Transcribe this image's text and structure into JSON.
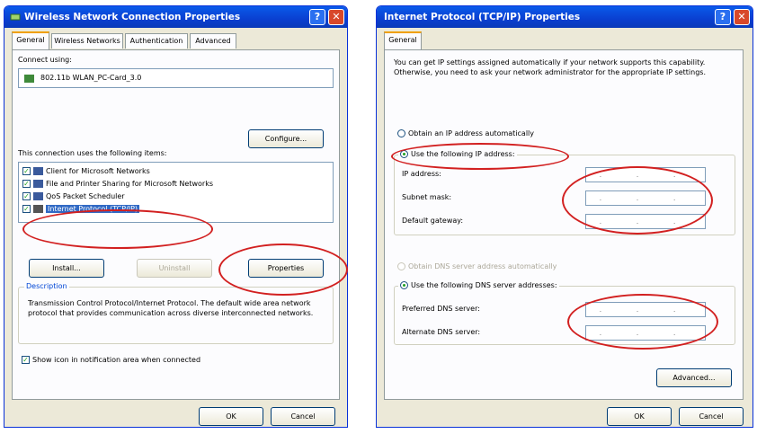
{
  "left_dialog": {
    "title": "Wireless Network Connection Properties",
    "tabs": [
      "General",
      "Wireless Networks",
      "Authentication",
      "Advanced"
    ],
    "connect_using_label": "Connect using:",
    "adapter_name": "802.11b WLAN_PC-Card_3.0",
    "configure_label": "Configure...",
    "items_label": "This connection uses the following items:",
    "items": [
      {
        "label": "Client for Microsoft Networks",
        "checked": true
      },
      {
        "label": "File and Printer Sharing for Microsoft Networks",
        "checked": true
      },
      {
        "label": "QoS Packet Scheduler",
        "checked": true
      },
      {
        "label": "Internet Protocol (TCP/IP)",
        "checked": true,
        "selected": true
      }
    ],
    "install_label": "Install...",
    "uninstall_label": "Uninstall",
    "properties_label": "Properties",
    "description_group": "Description",
    "description_text": "Transmission Control Protocol/Internet Protocol. The default wide area network protocol that provides communication across diverse interconnected networks.",
    "show_icon_label": "Show icon in notification area when connected",
    "ok_label": "OK",
    "cancel_label": "Cancel"
  },
  "right_dialog": {
    "title": "Internet Protocol (TCP/IP) Properties",
    "tabs": [
      "General"
    ],
    "intro_text": "You can get IP settings assigned automatically if your network supports this capability. Otherwise, you need to ask your network administrator for the appropriate IP settings.",
    "obtain_ip_auto": "Obtain an IP address automatically",
    "use_following_ip": "Use the following IP address:",
    "ip_address_label": "IP address:",
    "subnet_mask_label": "Subnet mask:",
    "default_gateway_label": "Default gateway:",
    "field_dots": ". . .",
    "obtain_dns_auto": "Obtain DNS server address automatically",
    "use_following_dns": "Use the following DNS server addresses:",
    "preferred_dns_label": "Preferred DNS server:",
    "alternate_dns_label": "Alternate DNS server:",
    "advanced_label": "Advanced...",
    "ok_label": "OK",
    "cancel_label": "Cancel"
  },
  "colors": {
    "annotation_oval": "#d22020",
    "titlebar": "#0a4fdc",
    "dialog_bg": "#ece9d8"
  }
}
